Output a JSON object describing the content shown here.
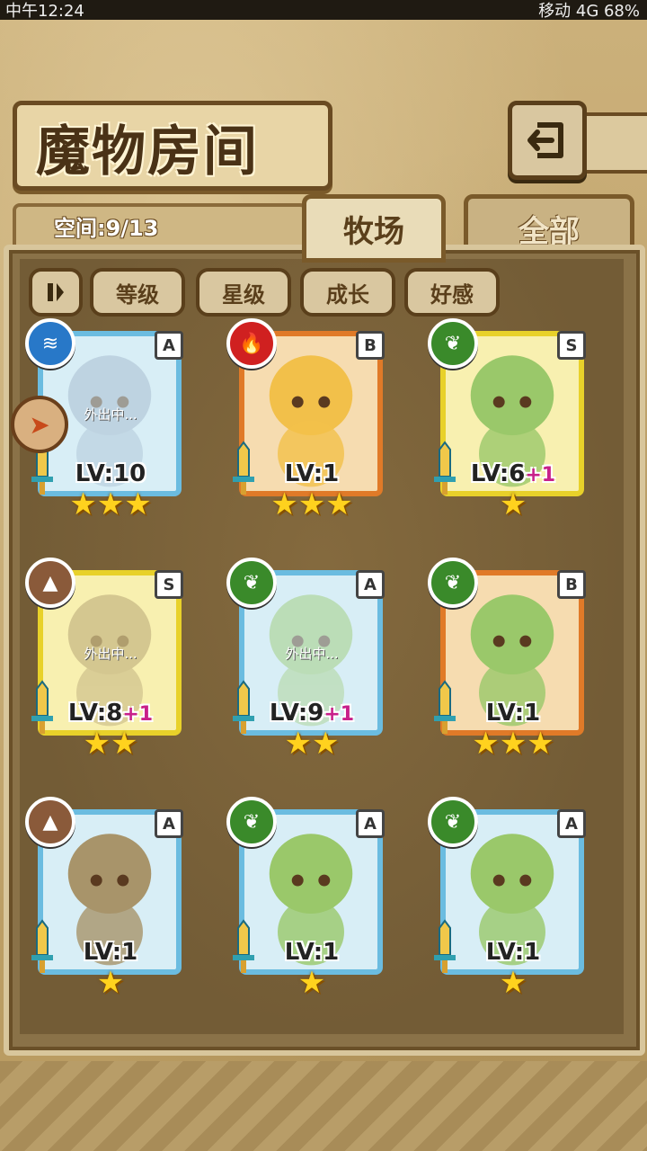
{
  "status_bar": {
    "left": "中午12:24",
    "right": "移动 4G 68%"
  },
  "header": {
    "title": "魔物房间",
    "back_icon": "back-arrow-icon"
  },
  "space": {
    "label": "空间:9/13"
  },
  "tabs": [
    {
      "label": "牧场",
      "active": true
    },
    {
      "label": "全部",
      "active": false
    }
  ],
  "filters": {
    "pause_icon": "pause-icon",
    "level": "等级",
    "star": "星级",
    "growth": "成长",
    "affinity": "好感"
  },
  "monsters": [
    {
      "rank": "A",
      "element": "water",
      "lv": "LV:10",
      "plus": "",
      "stars": "★★★",
      "away": "外出中..."
    },
    {
      "rank": "B",
      "element": "fire",
      "lv": "LV:1",
      "plus": "",
      "stars": "★★★",
      "away": ""
    },
    {
      "rank": "S",
      "element": "leaf",
      "lv": "LV:6",
      "plus": "+1",
      "stars": "★",
      "away": ""
    },
    {
      "rank": "S",
      "element": "earth",
      "lv": "LV:8",
      "plus": "+1",
      "stars": "★★",
      "away": "外出中..."
    },
    {
      "rank": "A",
      "element": "leaf",
      "lv": "LV:9",
      "plus": "+1",
      "stars": "★★",
      "away": "外出中..."
    },
    {
      "rank": "B",
      "element": "leaf",
      "lv": "LV:1",
      "plus": "",
      "stars": "★★★",
      "away": ""
    },
    {
      "rank": "A",
      "element": "earth",
      "lv": "LV:1",
      "plus": "",
      "stars": "★",
      "away": ""
    },
    {
      "rank": "A",
      "element": "leaf",
      "lv": "LV:1",
      "plus": "",
      "stars": "★",
      "away": ""
    },
    {
      "rank": "A",
      "element": "leaf",
      "lv": "LV:1",
      "plus": "",
      "stars": "★",
      "away": ""
    }
  ],
  "colors": {
    "rank_A": "#6bbce0",
    "rank_B": "#e07a28",
    "rank_S": "#e8d12a"
  }
}
